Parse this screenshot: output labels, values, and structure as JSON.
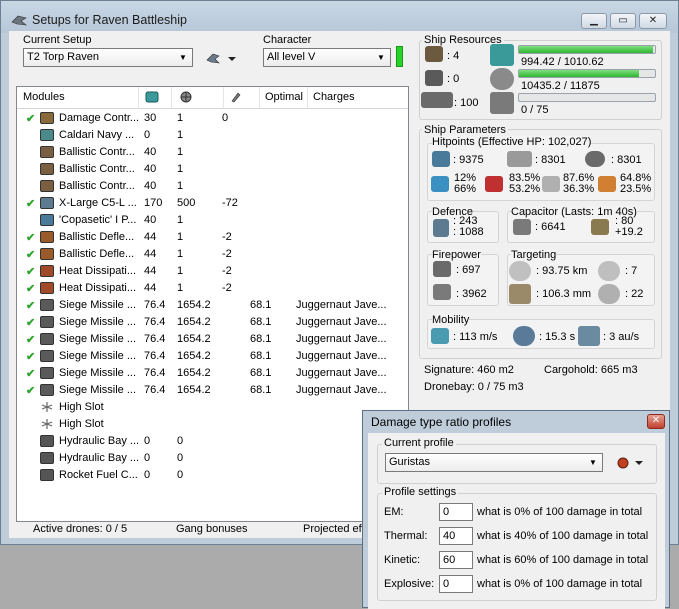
{
  "window": {
    "title": "Setups for Raven Battleship"
  },
  "setup": {
    "label": "Current Setup",
    "value": "T2 Torp Raven"
  },
  "character": {
    "label": "Character",
    "value": "All level V"
  },
  "modules": {
    "headers": {
      "name": "Modules",
      "optimal": "Optimal",
      "charges": "Charges"
    },
    "rows": [
      {
        "check": "✔",
        "name": "Damage Contr...",
        "c1": "30",
        "c2": "1",
        "c3": "0",
        "optimal": "",
        "charges": "",
        "icon": "damage-control-icon",
        "color": "#8a6a3a"
      },
      {
        "check": "",
        "name": "Caldari Navy ...",
        "c1": "0",
        "c2": "1",
        "c3": "",
        "optimal": "",
        "charges": "",
        "icon": "navy-module-icon",
        "color": "#4a8a8a"
      },
      {
        "check": "",
        "name": "Ballistic Contr...",
        "c1": "40",
        "c2": "1",
        "c3": "",
        "optimal": "",
        "charges": "",
        "icon": "ballistic-control-icon",
        "color": "#7a6040"
      },
      {
        "check": "",
        "name": "Ballistic Contr...",
        "c1": "40",
        "c2": "1",
        "c3": "",
        "optimal": "",
        "charges": "",
        "icon": "ballistic-control-icon",
        "color": "#7a6040"
      },
      {
        "check": "",
        "name": "Ballistic Contr...",
        "c1": "40",
        "c2": "1",
        "c3": "",
        "optimal": "",
        "charges": "",
        "icon": "ballistic-control-icon",
        "color": "#7a6040"
      },
      {
        "check": "✔",
        "name": "X-Large C5-L ...",
        "c1": "170",
        "c2": "500",
        "c3": "-72",
        "optimal": "",
        "charges": "",
        "icon": "shield-extender-icon",
        "color": "#5c7a90"
      },
      {
        "check": "",
        "name": "'Copasetic' I P...",
        "c1": "40",
        "c2": "1",
        "c3": "",
        "optimal": "",
        "charges": "",
        "icon": "power-diag-icon",
        "color": "#4a7a9a"
      },
      {
        "check": "✔",
        "name": "Ballistic Defle...",
        "c1": "44",
        "c2": "1",
        "c3": "-2",
        "optimal": "",
        "charges": "",
        "icon": "deflection-field-icon",
        "color": "#9a5a2a"
      },
      {
        "check": "✔",
        "name": "Ballistic Defle...",
        "c1": "44",
        "c2": "1",
        "c3": "-2",
        "optimal": "",
        "charges": "",
        "icon": "deflection-field-icon",
        "color": "#9a5a2a"
      },
      {
        "check": "✔",
        "name": "Heat Dissipati...",
        "c1": "44",
        "c2": "1",
        "c3": "-2",
        "optimal": "",
        "charges": "",
        "icon": "heat-dissipation-icon",
        "color": "#a04a2a"
      },
      {
        "check": "✔",
        "name": "Heat Dissipati...",
        "c1": "44",
        "c2": "1",
        "c3": "-2",
        "optimal": "",
        "charges": "",
        "icon": "heat-dissipation-icon",
        "color": "#a04a2a"
      },
      {
        "check": "✔",
        "name": "Siege Missile ...",
        "c1": "76.4",
        "c2": "1654.2",
        "c3": "",
        "optimal": "68.1",
        "charges": "Juggernaut Jave...",
        "icon": "missile-launcher-icon",
        "color": "#5a5a5a"
      },
      {
        "check": "✔",
        "name": "Siege Missile ...",
        "c1": "76.4",
        "c2": "1654.2",
        "c3": "",
        "optimal": "68.1",
        "charges": "Juggernaut Jave...",
        "icon": "missile-launcher-icon",
        "color": "#5a5a5a"
      },
      {
        "check": "✔",
        "name": "Siege Missile ...",
        "c1": "76.4",
        "c2": "1654.2",
        "c3": "",
        "optimal": "68.1",
        "charges": "Juggernaut Jave...",
        "icon": "missile-launcher-icon",
        "color": "#5a5a5a"
      },
      {
        "check": "✔",
        "name": "Siege Missile ...",
        "c1": "76.4",
        "c2": "1654.2",
        "c3": "",
        "optimal": "68.1",
        "charges": "Juggernaut Jave...",
        "icon": "missile-launcher-icon",
        "color": "#5a5a5a"
      },
      {
        "check": "✔",
        "name": "Siege Missile ...",
        "c1": "76.4",
        "c2": "1654.2",
        "c3": "",
        "optimal": "68.1",
        "charges": "Juggernaut Jave...",
        "icon": "missile-launcher-icon",
        "color": "#5a5a5a"
      },
      {
        "check": "✔",
        "name": "Siege Missile ...",
        "c1": "76.4",
        "c2": "1654.2",
        "c3": "",
        "optimal": "68.1",
        "charges": "Juggernaut Jave...",
        "icon": "missile-launcher-icon",
        "color": "#5a5a5a"
      },
      {
        "check": "",
        "name": "High Slot",
        "c1": "",
        "c2": "",
        "c3": "",
        "optimal": "",
        "charges": "",
        "icon": "empty-slot-icon",
        "color": "#ffffff"
      },
      {
        "check": "",
        "name": "High Slot",
        "c1": "",
        "c2": "",
        "c3": "",
        "optimal": "",
        "charges": "",
        "icon": "empty-slot-icon",
        "color": "#ffffff"
      },
      {
        "check": "",
        "name": "Hydraulic Bay ...",
        "c1": "0",
        "c2": "0",
        "c3": "",
        "optimal": "",
        "charges": "",
        "icon": "rig-icon",
        "color": "#555555"
      },
      {
        "check": "",
        "name": "Hydraulic Bay ...",
        "c1": "0",
        "c2": "0",
        "c3": "",
        "optimal": "",
        "charges": "",
        "icon": "rig-icon",
        "color": "#555555"
      },
      {
        "check": "",
        "name": "Rocket Fuel C...",
        "c1": "0",
        "c2": "0",
        "c3": "",
        "optimal": "",
        "charges": "",
        "icon": "rig-icon",
        "color": "#555555"
      }
    ]
  },
  "status": {
    "drones": "Active drones: 0 / 5",
    "gang": "Gang bonuses",
    "projected": "Projected eff"
  },
  "resources": {
    "title": "Ship Resources",
    "turret": ": 4",
    "launcher": ": 0",
    "drone_bw": ": 100",
    "cpu": {
      "text": "994.42 / 1010.62",
      "fraction": 0.984
    },
    "pg": {
      "text": "10435.2 / 11875",
      "fraction": 0.879
    },
    "calib": {
      "text": "0 / 75",
      "fraction": 0.0
    }
  },
  "params": {
    "title": "Ship Parameters",
    "hp_label": "Hitpoints (Effective HP: 102,027)",
    "shield_hp": ": 9375",
    "armor_hp": ": 8301",
    "struct_hp": ": 8301",
    "shield_res": [
      "12%",
      "66%"
    ],
    "armor_res": [
      "83.5%",
      "53.2%"
    ],
    "kin_res": [
      "87.6%",
      "36.3%"
    ],
    "exp_res": [
      "64.8%",
      "23.5%"
    ],
    "defence_label": "Defence",
    "defence": [
      "243",
      "1088"
    ],
    "cap_label": "Capacitor (Lasts: 1m 40s)",
    "cap": ": 6641",
    "cap_rate": [
      "80",
      "+19.2"
    ],
    "fp_label": "Firepower",
    "dps": ": 697",
    "volley": ": 3962",
    "tgt_label": "Targeting",
    "range": ": 93.75 km",
    "max_targets": ": 7",
    "scan_res": ": 106.3 mm",
    "sensor": ": 22",
    "mob_label": "Mobility",
    "speed": ": 113 m/s",
    "align": ": 15.3 s",
    "warp": ": 3 au/s",
    "signature": "Signature: 460 m2",
    "cargo": "Cargohold: 665 m3",
    "dronebay": "Dronebay: 0 / 75 m3"
  },
  "dialog": {
    "title": "Damage type ratio profiles",
    "profile_label": "Current profile",
    "profile_value": "Guristas",
    "settings_label": "Profile settings",
    "rows": [
      {
        "label": "EM:",
        "value": "0",
        "desc": "what is 0% of 100 damage in total"
      },
      {
        "label": "Thermal:",
        "value": "40",
        "desc": "what is 40% of 100 damage in total"
      },
      {
        "label": "Kinetic:",
        "value": "60",
        "desc": "what is 60% of 100 damage in total"
      },
      {
        "label": "Explosive:",
        "value": "0",
        "desc": "what is 0% of 100 damage in total"
      }
    ]
  }
}
